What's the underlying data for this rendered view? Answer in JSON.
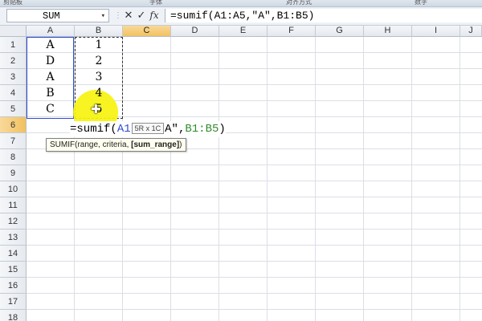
{
  "ribbon_fragments": [
    "剪贴板",
    "字体",
    "对齐方式",
    "数字"
  ],
  "formula_bar": {
    "name_box": "SUM",
    "name_box_arrow": "▾",
    "grip": "⋮",
    "cancel": "✕",
    "enter": "✓",
    "fx": "fx",
    "formula": "=sumif(A1:A5,\"A\",B1:B5)"
  },
  "columns": [
    "A",
    "B",
    "C",
    "D",
    "E",
    "F",
    "G",
    "H",
    "I",
    "J"
  ],
  "selected_column": "C",
  "rows": [
    "1",
    "2",
    "3",
    "4",
    "5",
    "6",
    "7",
    "8",
    "9",
    "10",
    "11",
    "12",
    "13",
    "14",
    "15",
    "16",
    "17",
    "18"
  ],
  "selected_row": "6",
  "column_a": [
    "A",
    "D",
    "A",
    "B",
    "C"
  ],
  "column_b": [
    "1",
    "2",
    "3",
    "4",
    "5"
  ],
  "edit_cell": {
    "prefix": "=sumif(",
    "ref_a": "A1",
    "size_tip": "5R x 1C",
    "criteria_text": "A\",",
    "ref_b": "B1:B5",
    "suffix": ")"
  },
  "tooltip": {
    "text": "SUMIF(range, criteria, ",
    "bold_text": "[sum_range]",
    "end": ")"
  },
  "colors": {
    "range_blue": "#2e4bd0",
    "range_green": "#2f8a2f",
    "highlight": "#f6f30f",
    "selected_header": "#f1c15f"
  }
}
